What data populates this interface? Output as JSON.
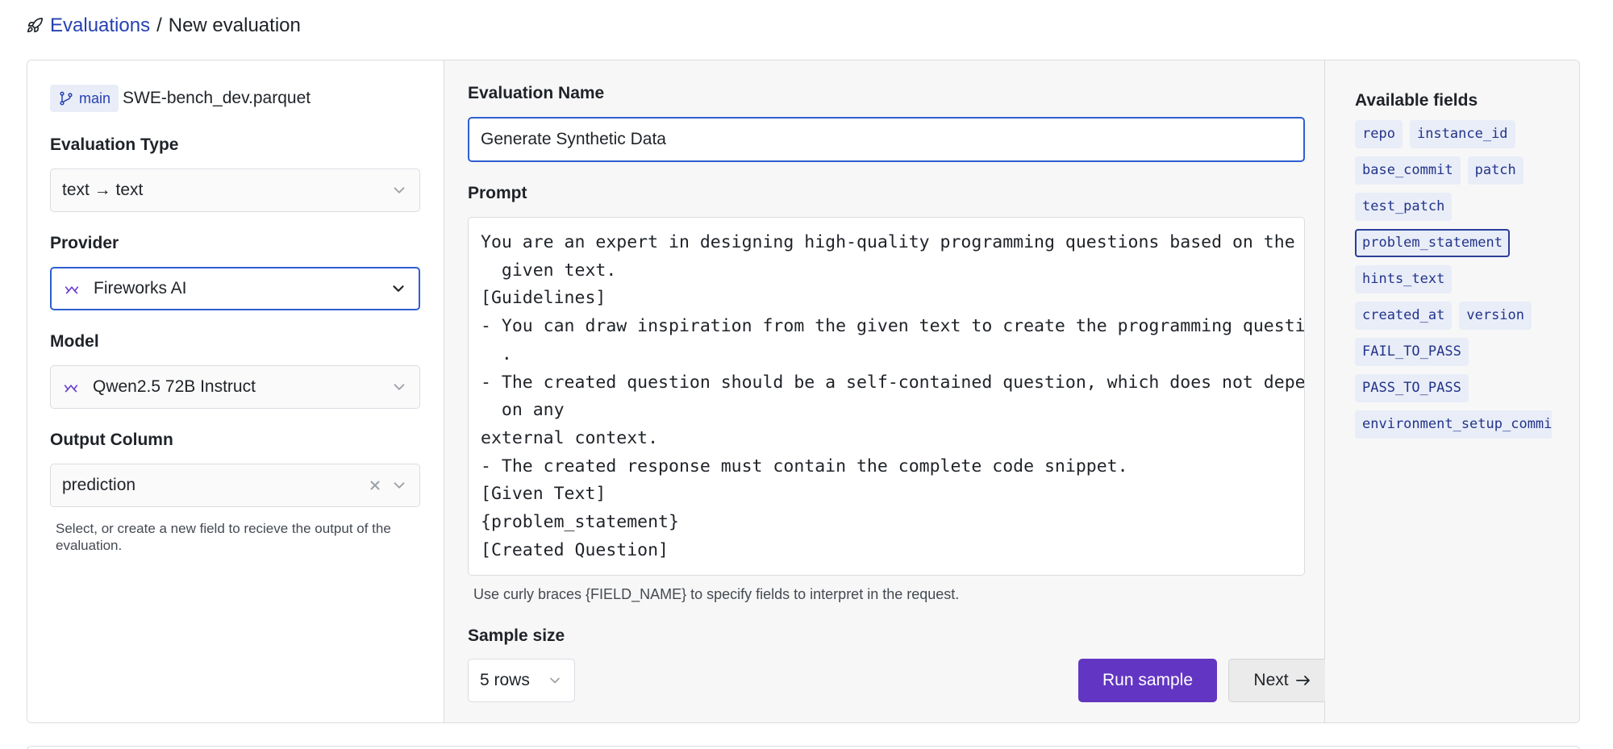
{
  "breadcrumb": {
    "root": "Evaluations",
    "separator": "/",
    "current": "New evaluation"
  },
  "dataset": {
    "branch": "main",
    "file": "SWE-bench_dev.parquet"
  },
  "evaluation_type": {
    "label": "Evaluation Type",
    "value": "text → text"
  },
  "provider": {
    "label": "Provider",
    "value": "Fireworks AI",
    "icon": "fireworks-logo-icon"
  },
  "model": {
    "label": "Model",
    "value": "Qwen2.5 72B Instruct",
    "icon": "fireworks-logo-icon"
  },
  "output_column": {
    "label": "Output Column",
    "value": "prediction",
    "helper": "Select, or create a new field to recieve the output of the evaluation."
  },
  "evaluation_name": {
    "label": "Evaluation Name",
    "value": "Generate Synthetic Data"
  },
  "prompt": {
    "label": "Prompt",
    "lines": [
      "You are an expert in designing high-quality programming questions based on the",
      "  given text.",
      "[Guidelines]",
      "- You can draw inspiration from the given text to create the programming questions",
      "  .",
      "- The created question should be a self-contained question, which does not depend",
      "  on any",
      "external context.",
      "- The created response must contain the complete code snippet.",
      "[Given Text]",
      "{problem_statement}",
      "",
      "[Created Question]"
    ],
    "hint": "Use curly braces {FIELD_NAME} to specify fields to interpret in the request."
  },
  "sample_size": {
    "label": "Sample size",
    "value": "5 rows"
  },
  "actions": {
    "run_sample": "Run sample",
    "next": "Next"
  },
  "available_fields": {
    "title": "Available fields",
    "selected": "problem_statement",
    "rows": [
      [
        "repo",
        "instance_id"
      ],
      [
        "base_commit",
        "patch"
      ],
      [
        "test_patch"
      ],
      [
        "problem_statement"
      ],
      [
        "hints_text"
      ],
      [
        "created_at",
        "version"
      ],
      [
        "FAIL_TO_PASS"
      ],
      [
        "PASS_TO_PASS"
      ],
      [
        "environment_setup_commit"
      ]
    ]
  },
  "colors": {
    "accent": "#2f5fd0",
    "link": "#2541b2",
    "primary_button": "#6236c2",
    "chip_bg": "#e9edf8",
    "chip_text": "#22348a",
    "provider_icon": "#6b3fd0"
  }
}
